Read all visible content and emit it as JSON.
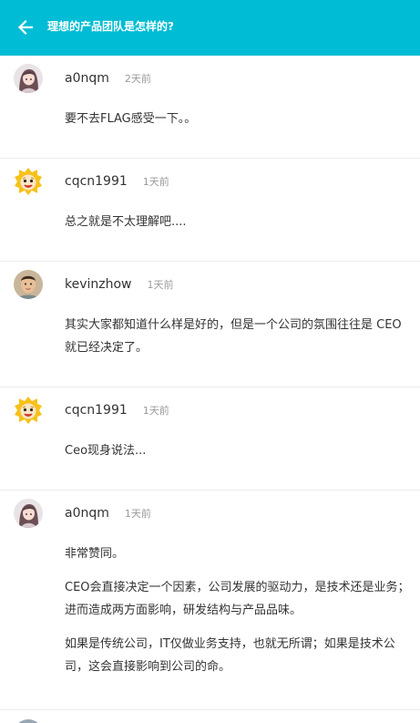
{
  "header": {
    "title": "理想的产品团队是怎样的?",
    "back_icon": "arrow-left-icon",
    "bg_color": "#00bcd4"
  },
  "comments": [
    {
      "username": "a0nqm",
      "time": "2天前",
      "avatar": "anime-girl-avatar",
      "paragraphs": [
        "要不去FLAG感受一下。。"
      ]
    },
    {
      "username": "cqcn1991",
      "time": "1天前",
      "avatar": "lion-avatar",
      "paragraphs": [
        "总之就是不太理解吧...."
      ]
    },
    {
      "username": "kevinzhow",
      "time": "1天前",
      "avatar": "person-photo-avatar",
      "paragraphs": [
        "其实大家都知道什么样是好的，但是一个公司的氛围往往是 CEO 就已经决定了。"
      ]
    },
    {
      "username": "cqcn1991",
      "time": "1天前",
      "avatar": "lion-avatar",
      "paragraphs": [
        "Ceo现身说法..."
      ]
    },
    {
      "username": "a0nqm",
      "time": "1天前",
      "avatar": "anime-girl-avatar",
      "paragraphs": [
        "非常赞同。",
        "CEO会直接决定一个因素，公司发展的驱动力，是技术还是业务；进而造成两方面影响，研发结构与产品品味。",
        "如果是传统公司，IT仅做业务支持，也就无所谓；如果是技术公司，这会直接影响到公司的命。"
      ]
    }
  ]
}
